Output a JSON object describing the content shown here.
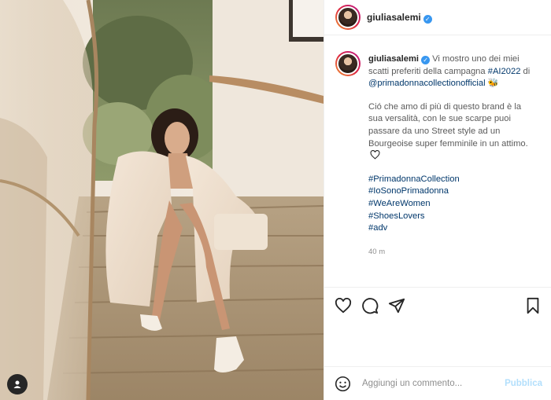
{
  "post": {
    "username": "giuliasalemi",
    "verified": true,
    "caption": {
      "intro_text": "Vi mostro uno dei miei scatti preferiti della campagna",
      "campaign_tag": "#AI2022",
      "di": "di",
      "mention": "@primadonnacollectionofficial",
      "emoji": "🐝",
      "paragraph": "Ció che amo di più di questo brand è la sua versalità, con le sue scarpe puoi passare da uno Street style ad un Bourgeoise super femminile in un attimo.",
      "hashtags": [
        "#PrimadonnaCollection",
        "#IoSonoPrimadonna",
        "#WeAreWomen",
        "#ShoesLovers",
        "#adv"
      ]
    },
    "timestamp": "40 m"
  },
  "actions": {
    "icons": [
      "heart-icon",
      "comment-icon",
      "share-icon",
      "bookmark-icon"
    ]
  },
  "comment_box": {
    "placeholder": "Aggiungi un commento...",
    "publish_label": "Pubblica"
  },
  "colors": {
    "link": "#00376b",
    "verified": "#3897f0",
    "publish_disabled": "#b2dffc",
    "border": "#efefef"
  }
}
